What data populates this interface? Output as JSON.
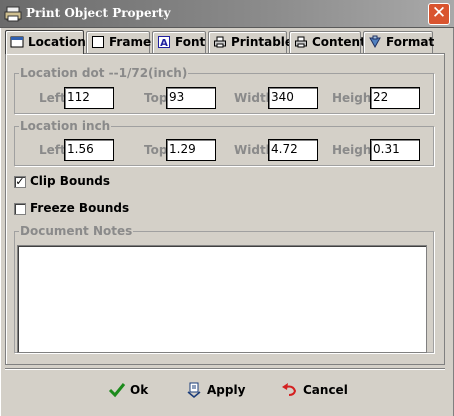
{
  "window": {
    "title": "Print Object Property",
    "close_glyph": "✕"
  },
  "tabs": [
    {
      "label": "Location",
      "icon": "location-icon",
      "active": true
    },
    {
      "label": "Frame",
      "icon": "frame-icon",
      "active": false
    },
    {
      "label": "Font",
      "icon": "font-icon",
      "active": false
    },
    {
      "label": "Printable",
      "icon": "printer-icon",
      "active": false
    },
    {
      "label": "Content",
      "icon": "printer-icon",
      "active": false
    },
    {
      "label": "Format",
      "icon": "format-icon",
      "active": false
    }
  ],
  "location_dot": {
    "title": "Location dot --1/72(inch)",
    "left_label": "Left",
    "left_value": "112",
    "top_label": "Top",
    "top_value": "93",
    "width_label": "Width",
    "width_value": "340",
    "height_label": "Height",
    "height_value": "22"
  },
  "location_inch": {
    "title": "Location inch",
    "left_label": "Left",
    "left_value": "1.56",
    "top_label": "Top",
    "top_value": "1.29",
    "width_label": "Width",
    "width_value": "4.72",
    "height_label": "Height",
    "height_value": "0.31"
  },
  "options": {
    "clip_bounds_label": "Clip Bounds",
    "clip_bounds_checked": true,
    "freeze_bounds_label": "Freeze Bounds",
    "freeze_bounds_checked": false
  },
  "notes": {
    "title": "Document Notes",
    "value": ""
  },
  "buttons": {
    "ok_label": "Ok",
    "apply_label": "Apply",
    "cancel_label": "Cancel"
  },
  "colors": {
    "title_bar": "#6b6b6b",
    "close": "#d9542f",
    "dialog_bg": "#d4d0c8",
    "label_grey": "#8a8a8a",
    "ok_green": "#1c8a1c",
    "cancel_red": "#d42020"
  }
}
